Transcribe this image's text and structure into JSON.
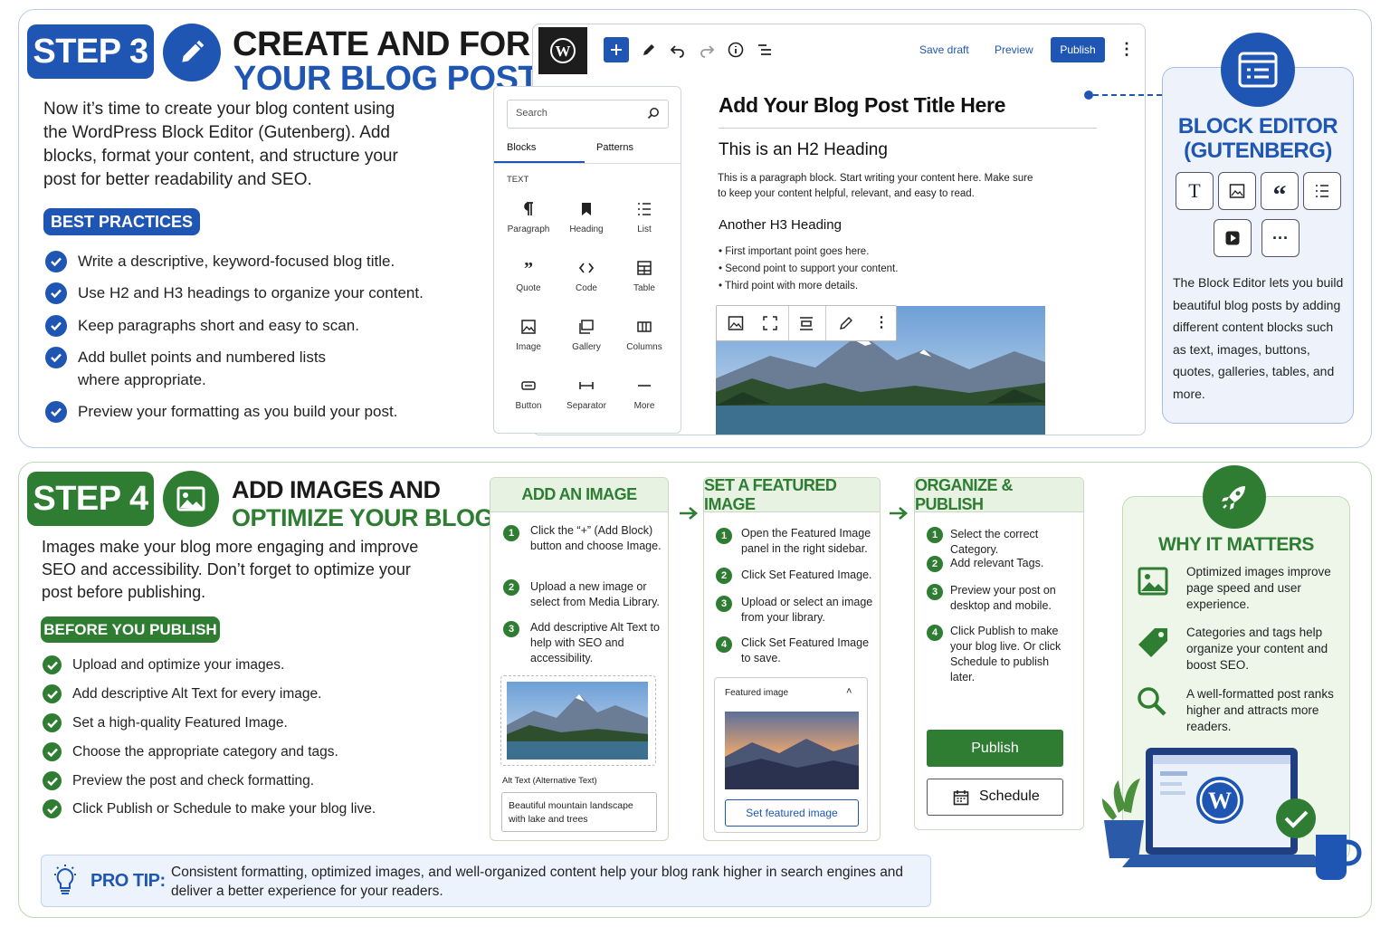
{
  "step3": {
    "badge": "STEP 3",
    "title_line1": "CREATE AND FORMAT",
    "title_line2": "YOUR BLOG POST",
    "intro": "Now it’s time to create your blog content using the WordPress Block Editor (Gutenberg). Add blocks, format your content, and structure your post for better readability and SEO.",
    "best_practices_label": "BEST PRACTICES",
    "practices": [
      "Write a descriptive, keyword-focused blog title.",
      "Use H2 and H3 headings to organize your content.",
      "Keep paragraphs short and easy to scan.",
      "Add bullet points and numbered lists",
      "where appropriate.",
      "Preview your formatting as you build your post."
    ]
  },
  "editor": {
    "save_draft": "Save draft",
    "preview": "Preview",
    "publish": "Publish",
    "search_placeholder": "Search",
    "tabs": [
      "Blocks",
      "Patterns"
    ],
    "section_label": "TEXT",
    "blocks": [
      "Paragraph",
      "Heading",
      "List",
      "Quote",
      "Code",
      "Table",
      "Image",
      "Gallery",
      "Columns",
      "Button",
      "Separator",
      "More"
    ],
    "post_title": "Add Your Blog Post Title Here",
    "h2": "This is an H2 Heading",
    "paragraph": "This is a paragraph block. Start writing your content here. Make sure to keep your content helpful, relevant, and easy to read.",
    "h3": "Another H3 Heading",
    "bullets": [
      "First important point goes here.",
      "Second point to support your content.",
      "Third point with more details."
    ]
  },
  "sidebar": {
    "title_line1": "BLOCK EDITOR",
    "title_line2": "(GUTENBERG)",
    "description": "The Block Editor lets you build beautiful blog posts by adding different content blocks such as text, images, buttons, quotes, galleries, tables, and more."
  },
  "step4": {
    "badge": "STEP 4",
    "title_line1": "ADD IMAGES AND",
    "title_line2": "OPTIMIZE YOUR BLOG POST",
    "intro": "Images make your blog more engaging and improve SEO and accessibility. Don’t forget to optimize your post before publishing.",
    "before_label": "BEFORE YOU PUBLISH",
    "checklist": [
      "Upload and optimize your images.",
      "Add descriptive Alt Text for every image.",
      "Set a high-quality Featured Image.",
      "Choose the appropriate category and tags.",
      "Preview the post and check formatting.",
      "Click Publish or Schedule to make your blog live."
    ]
  },
  "card_image": {
    "title": "ADD AN IMAGE",
    "steps": [
      "Click the “+” (Add Block) button and choose Image.",
      "Upload a new image or select from Media Library.",
      "Add descriptive Alt Text to help with SEO and accessibility."
    ],
    "alt_label": "Alt Text (Alternative Text)",
    "alt_value": "Beautiful mountain landscape with lake and trees"
  },
  "card_featured": {
    "title": "SET A FEATURED IMAGE",
    "steps": [
      "Open the Featured Image panel in the right sidebar.",
      "Click Set Featured Image.",
      "Upload or select an image from your library.",
      "Click Set Featured Image to save."
    ],
    "panel_label": "Featured image",
    "button": "Set featured image"
  },
  "card_publish": {
    "title": "ORGANIZE & PUBLISH",
    "steps": [
      "Select the correct Category.",
      "Add relevant Tags.",
      "Preview your post on desktop and mobile.",
      "Click Publish to make your blog live. Or click Schedule to publish later."
    ],
    "publish": "Publish",
    "schedule": "Schedule"
  },
  "why": {
    "title": "WHY IT MATTERS",
    "items": [
      "Optimized images improve page speed and user experience.",
      "Categories and tags help organize your content and boost SEO.",
      "A well-formatted post ranks higher and attracts more readers."
    ]
  },
  "tip": {
    "label": "PRO TIP:",
    "text": "Consistent formatting, optimized images, and well-organized content help your blog rank higher in search engines and deliver a better experience for your readers."
  },
  "colors": {
    "blue": "#1f56b3",
    "green": "#2e7d32"
  }
}
